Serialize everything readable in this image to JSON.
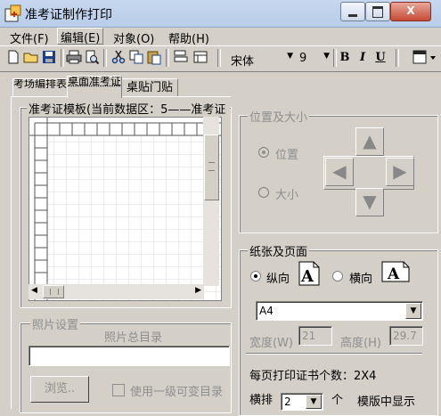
{
  "window": {
    "title": "准考证制作打印",
    "close_glyph": "X"
  },
  "menu": [
    {
      "label": "文件(F)"
    },
    {
      "label": "编辑(E)"
    },
    {
      "label": "对象(O)"
    },
    {
      "label": "帮助(H)"
    }
  ],
  "toolbar": {
    "font_name": "宋体",
    "font_size": "9",
    "bold": "B",
    "italic": "I",
    "underline": "U",
    "icons": [
      "new-file-icon",
      "open-folder-icon",
      "save-icon",
      "print-icon",
      "print-preview-icon",
      "cut-icon",
      "copy-icon",
      "paste-icon",
      "align-icon",
      "layout-icon",
      "display-menu-icon"
    ]
  },
  "tabs": [
    {
      "label": "考场编排表"
    },
    {
      "label": "桌面准考证"
    },
    {
      "label": "桌贴门贴"
    }
  ],
  "template_group": {
    "title": "准考证模板(当前数据区：5——准考证"
  },
  "photo_group": {
    "title": "照片设置",
    "dir_label": "照片总目录",
    "dir_value": "",
    "browse": "浏览..",
    "use_subdir": "使用一级可变目录"
  },
  "position_group": {
    "title": "位置及大小",
    "position": "位置",
    "size": "大小"
  },
  "paper_group": {
    "title": "纸张及页面",
    "portrait": "纵向",
    "landscape": "横向",
    "paper_size": "A4",
    "width_label": "宽度(W)",
    "width_value": "21",
    "height_label": "高度(H)",
    "height_value": "29.7",
    "per_page": "每页打印证书个数：2X4",
    "rows_label": "横排",
    "rows_value": "2",
    "unit": "个",
    "template_show": "模版中显示"
  }
}
